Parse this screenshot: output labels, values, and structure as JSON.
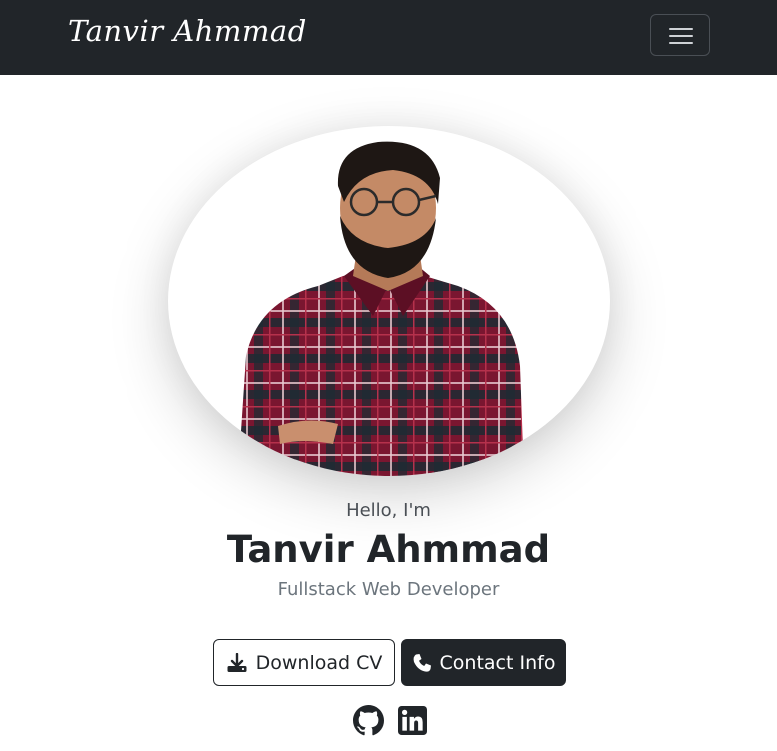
{
  "navbar": {
    "brand": "Tanvir Ahmmad",
    "toggle_icon": "hamburger-menu-icon"
  },
  "hero": {
    "photo_alt": "Tanvir Ahmmad portrait",
    "greeting": "Hello, I'm",
    "name": "Tanvir Ahmmad",
    "role": "Fullstack Web Developer"
  },
  "actions": {
    "download_label": "Download CV",
    "download_icon": "download-icon",
    "contact_label": "Contact Info",
    "contact_icon": "phone-icon"
  },
  "social": {
    "github_icon": "github-icon",
    "linkedin_icon": "linkedin-icon"
  },
  "colors": {
    "navbar_bg": "#212529",
    "primary_text": "#212529",
    "muted_text": "#6c757d",
    "button_dark": "#212529"
  }
}
